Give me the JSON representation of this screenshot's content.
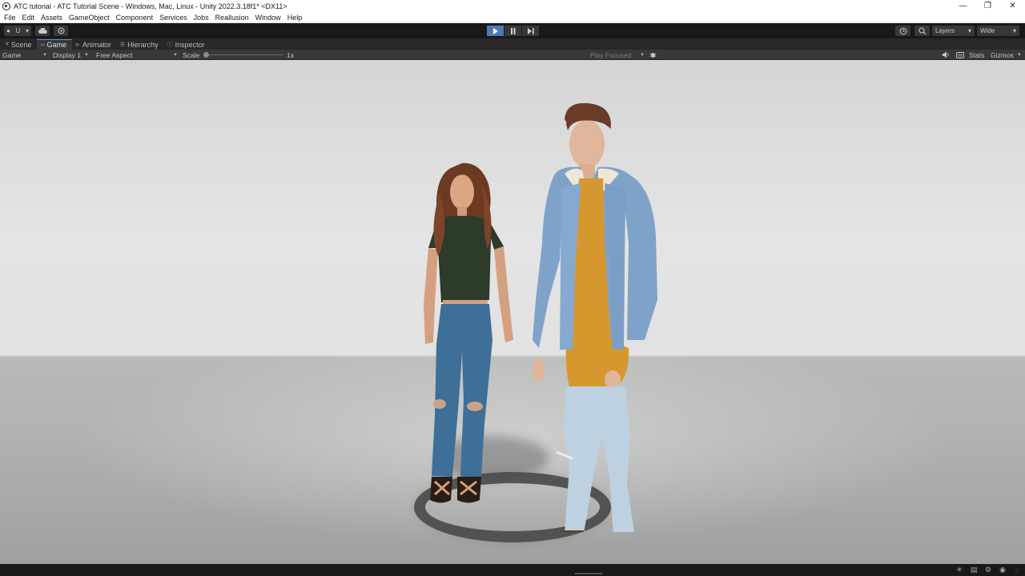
{
  "window": {
    "title": "ATC tutorial - ATC Tutorial Scene - Windows, Mac, Linux - Unity 2022.3.18f1* <DX11>",
    "controls": [
      "—",
      "❐",
      "✕"
    ]
  },
  "menu": [
    "File",
    "Edit",
    "Assets",
    "GameObject",
    "Component",
    "Services",
    "Jobs",
    "Reallusion",
    "Window",
    "Help"
  ],
  "toolbar": {
    "account_label": "U",
    "layers_label": "Layers",
    "layout_label": "Wide",
    "play_state": "playing"
  },
  "tabs": [
    {
      "label": "Scene",
      "icon": "scene-icon",
      "active": false
    },
    {
      "label": "Game",
      "icon": "game-icon",
      "active": true
    },
    {
      "label": "Animator",
      "icon": "animator-icon",
      "active": false
    },
    {
      "label": "Hierarchy",
      "icon": "hierarchy-icon",
      "active": false
    },
    {
      "label": "Inspector",
      "icon": "inspector-icon",
      "active": false
    }
  ],
  "gamebar": {
    "mode": "Game",
    "display": "Display 1",
    "aspect": "Free Aspect",
    "scale_label": "Scale",
    "scale_value": "1x",
    "play_mode": "Play Focused",
    "stats": "Stats",
    "gizmos": "Gizmos"
  },
  "colors": {
    "accent": "#4d7ab8",
    "editor_dark": "#191919",
    "panel": "#383838"
  }
}
